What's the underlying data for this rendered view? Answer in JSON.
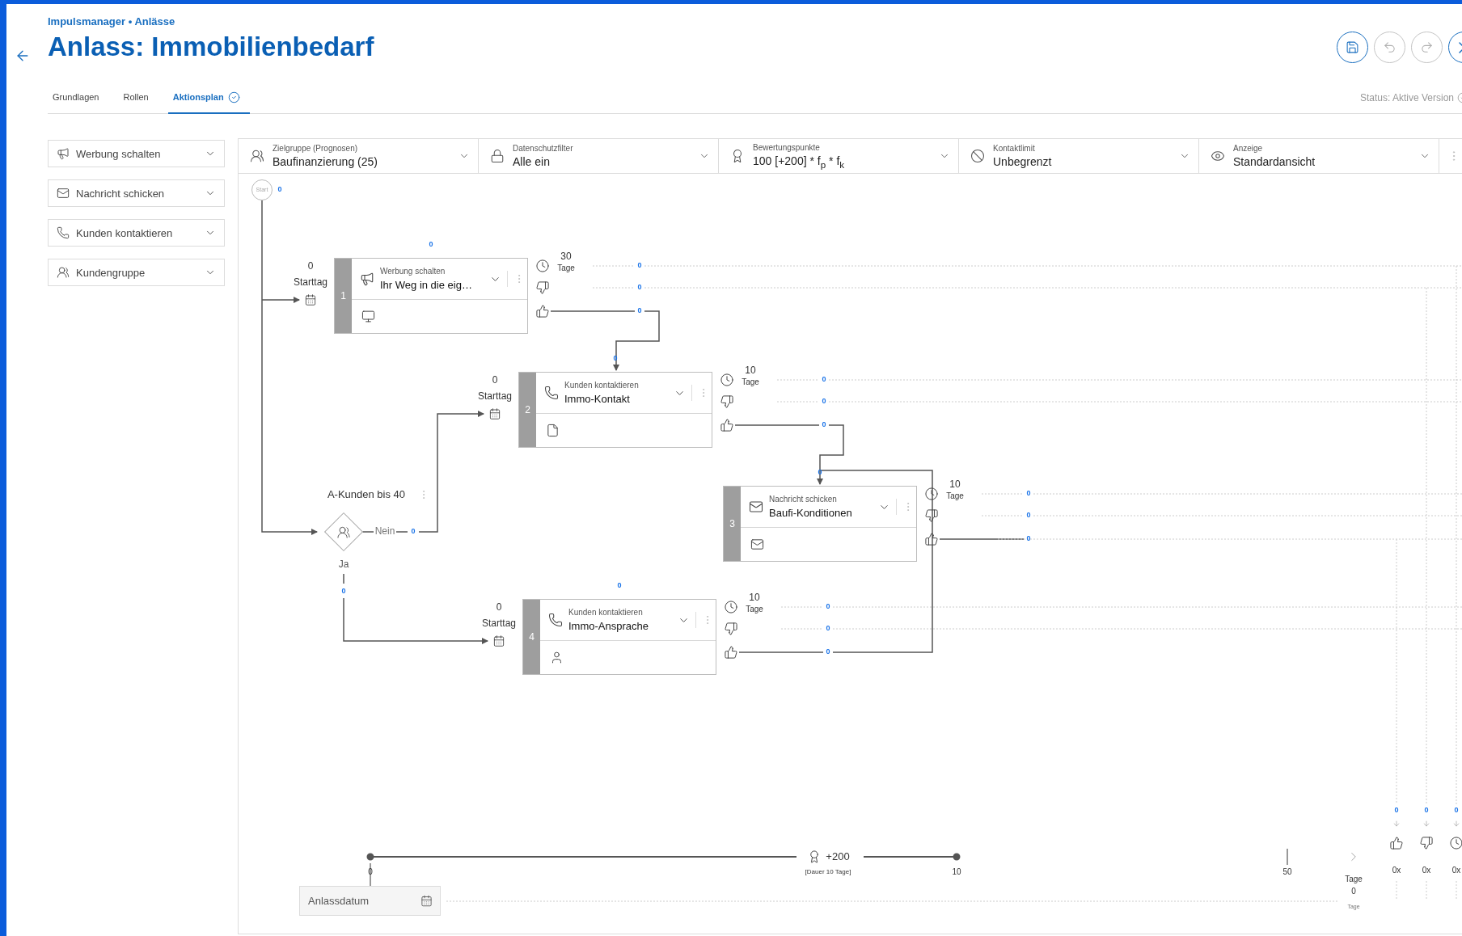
{
  "breadcrumb": "Impulsmanager • Anlässe",
  "title": "Anlass: Immobilienbedarf",
  "actions_bar": [
    {
      "kind": "save",
      "enabled": true
    },
    {
      "kind": "undo",
      "enabled": false
    },
    {
      "kind": "redo",
      "enabled": false
    },
    {
      "kind": "close",
      "enabled": true
    }
  ],
  "tabs": [
    {
      "label": "Grundlagen",
      "selected": false,
      "done": false
    },
    {
      "label": "Rollen",
      "selected": false,
      "done": false
    },
    {
      "label": "Aktionsplan",
      "selected": true,
      "done": true
    }
  ],
  "status": "Status: Aktive Version",
  "palette": [
    {
      "label": "Werbung schalten",
      "kind": "ad"
    },
    {
      "label": "Nachricht schicken",
      "kind": "message"
    },
    {
      "label": "Kunden kontaktieren",
      "kind": "phone"
    },
    {
      "label": "Kundengruppe",
      "kind": "group"
    }
  ],
  "filters": [
    {
      "label": "Zielgruppe (Prognosen)",
      "value": "Baufinanzierung (25)"
    },
    {
      "label": "Datenschutzfilter",
      "value": "Alle ein"
    },
    {
      "label": "Bewertungspunkte",
      "value": "100 [+200] * f$_{p}$ * f$_{k}$"
    },
    {
      "label": "Kontaktlimit",
      "value": "Unbegrenzt"
    },
    {
      "label": "Anzeige",
      "value": "Standardansicht"
    }
  ],
  "start": {
    "label": "Start",
    "count": "0"
  },
  "actions": [
    {
      "number": "1",
      "type": "Werbung schalten",
      "name": "Ihr Weg in die eig…",
      "kind": "ad",
      "count": "0",
      "start_day": "0",
      "start_label": "Starttag",
      "timeout": "30",
      "timeout_unit": "Tage",
      "outcomes": [
        {
          "kind": "timeout",
          "count": "0"
        },
        {
          "kind": "negative",
          "count": "0"
        },
        {
          "kind": "positive",
          "count": "0"
        }
      ]
    },
    {
      "number": "2",
      "type": "Kunden kontaktieren",
      "name": "Immo-Kontakt",
      "kind": "phone",
      "count": "0",
      "start_day": "0",
      "start_label": "Starttag",
      "timeout": "10",
      "timeout_unit": "Tage",
      "outcomes": [
        {
          "kind": "timeout",
          "count": "0"
        },
        {
          "kind": "negative",
          "count": "0"
        },
        {
          "kind": "positive",
          "count": "0"
        }
      ]
    },
    {
      "number": "3",
      "type": "Nachricht schicken",
      "name": "Baufi-Konditionen",
      "kind": "message",
      "count": "0",
      "timeout": "10",
      "timeout_unit": "Tage",
      "outcomes": [
        {
          "kind": "timeout",
          "count": "0"
        },
        {
          "kind": "negative",
          "count": "0"
        },
        {
          "kind": "positive",
          "count": "0"
        }
      ]
    },
    {
      "number": "4",
      "type": "Kunden kontaktieren",
      "name": "Immo-Ansprache",
      "kind": "phone",
      "count": "0",
      "start_day": "0",
      "start_label": "Starttag",
      "timeout": "10",
      "timeout_unit": "Tage",
      "outcomes": [
        {
          "kind": "timeout",
          "count": "0"
        },
        {
          "kind": "negative",
          "count": "0"
        },
        {
          "kind": "positive",
          "count": "0"
        }
      ]
    }
  ],
  "decision": {
    "label": "A-Kunden bis 40",
    "no_label": "Nein",
    "no_count": "0",
    "yes_label": "Ja",
    "yes_count": "0"
  },
  "timeline": {
    "start": "0",
    "reward": "+200",
    "duration": "[Dauer 10 Tage]",
    "end": "10",
    "mark": "50",
    "unit": "Tage",
    "days": "0",
    "days_unit": "Tage"
  },
  "date_field": {
    "placeholder": "Anlassdatum"
  },
  "summary": [
    {
      "kind": "positive",
      "count": "0",
      "total": "0x"
    },
    {
      "kind": "negative",
      "count": "0",
      "total": "0x"
    },
    {
      "kind": "timeout",
      "count": "0",
      "total": "0x"
    }
  ]
}
